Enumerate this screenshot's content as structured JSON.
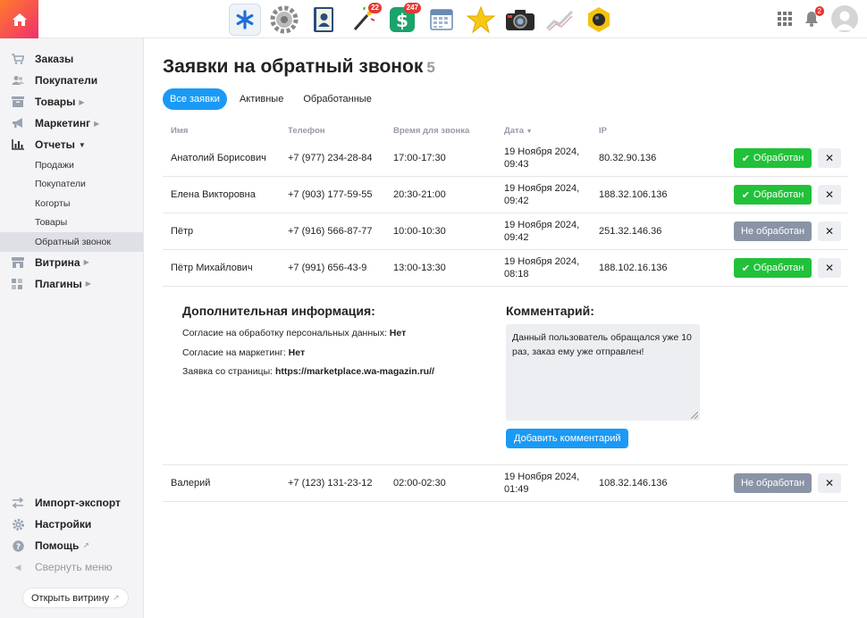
{
  "topbar": {
    "apps": [
      {
        "name": "asterisk-app-icon",
        "badge": ""
      },
      {
        "name": "gear-app-icon",
        "badge": ""
      },
      {
        "name": "contacts-app-icon",
        "badge": ""
      },
      {
        "name": "magic-wand-app-icon",
        "badge": "22"
      },
      {
        "name": "money-app-icon",
        "badge": "247"
      },
      {
        "name": "calendar-app-icon",
        "badge": ""
      },
      {
        "name": "star-app-icon",
        "badge": ""
      },
      {
        "name": "camera-app-icon",
        "badge": ""
      },
      {
        "name": "chart-app-icon",
        "badge": ""
      },
      {
        "name": "hexagon-app-icon",
        "badge": ""
      }
    ],
    "notifications_count": "2"
  },
  "sidebar": {
    "items": [
      {
        "label": "Заказы",
        "icon": "cart-icon"
      },
      {
        "label": "Покупатели",
        "icon": "users-icon"
      },
      {
        "label": "Товары",
        "icon": "box-icon"
      },
      {
        "label": "Маркетинг",
        "icon": "megaphone-icon"
      },
      {
        "label": "Отчеты",
        "icon": "bar-chart-icon"
      }
    ],
    "reports_sub": [
      "Продажи",
      "Покупатели",
      "Когорты",
      "Товары",
      "Обратный звонок"
    ],
    "items2": [
      {
        "label": "Витрина",
        "icon": "storefront-icon"
      },
      {
        "label": "Плагины",
        "icon": "plugins-icon"
      }
    ],
    "bottom": {
      "import_export": "Импорт-экспорт",
      "settings": "Настройки",
      "help": "Помощь",
      "collapse": "Свернуть меню"
    },
    "open_storefront": "Открыть витрину"
  },
  "page": {
    "title": "Заявки на обратный звонок",
    "count": "5",
    "tabs": [
      "Все заявки",
      "Активные",
      "Обработанные"
    ],
    "active_tab": 0
  },
  "table": {
    "headers": {
      "name": "Имя",
      "phone": "Телефон",
      "time": "Время для звонка",
      "date": "Дата",
      "ip": "IP"
    },
    "rows": [
      {
        "name": "Анатолий Борисович",
        "phone": "+7 (977) 234-28-84",
        "time": "17:00-17:30",
        "date1": "19 Ноября 2024,",
        "date2": "09:43",
        "ip": "80.32.90.136",
        "status": "Обработан",
        "done": true
      },
      {
        "name": "Елена Викторовна",
        "phone": "+7 (903) 177-59-55",
        "time": "20:30-21:00",
        "date1": "19 Ноября 2024,",
        "date2": "09:42",
        "ip": "188.32.106.136",
        "status": "Обработан",
        "done": true
      },
      {
        "name": "Пётр",
        "phone": "+7 (916) 566-87-77",
        "time": "10:00-10:30",
        "date1": "19 Ноября 2024,",
        "date2": "09:42",
        "ip": "251.32.146.36",
        "status": "Не обработан",
        "done": false
      },
      {
        "name": "Пётр Михайлович",
        "phone": "+7 (991) 656-43-9",
        "time": "13:00-13:30",
        "date1": "19 Ноября 2024,",
        "date2": "08:18",
        "ip": "188.102.16.136",
        "status": "Обработан",
        "done": true
      },
      {
        "name": "Валерий",
        "phone": "+7 (123) 131-23-12",
        "time": "02:00-02:30",
        "date1": "19 Ноября 2024,",
        "date2": "01:49",
        "ip": "108.32.146.136",
        "status": "Не обработан",
        "done": false
      }
    ]
  },
  "details": {
    "info_title": "Дополнительная информация:",
    "consent_personal_label": "Согласие на обработку персональных данных:",
    "consent_personal_value": "Нет",
    "consent_marketing_label": "Согласие на маркетинг:",
    "consent_marketing_value": "Нет",
    "source_label": "Заявка со страницы:",
    "source_value": "https://marketplace.wa-magazin.ru//",
    "comment_title": "Комментарий:",
    "comment_text": "Данный пользователь обращался уже 10 раз, заказ ему уже отправлен!",
    "add_comment": "Добавить комментарий"
  },
  "colors": {
    "accent": "#1a9af5",
    "done": "#22c13a",
    "todo": "#8a94a6"
  }
}
